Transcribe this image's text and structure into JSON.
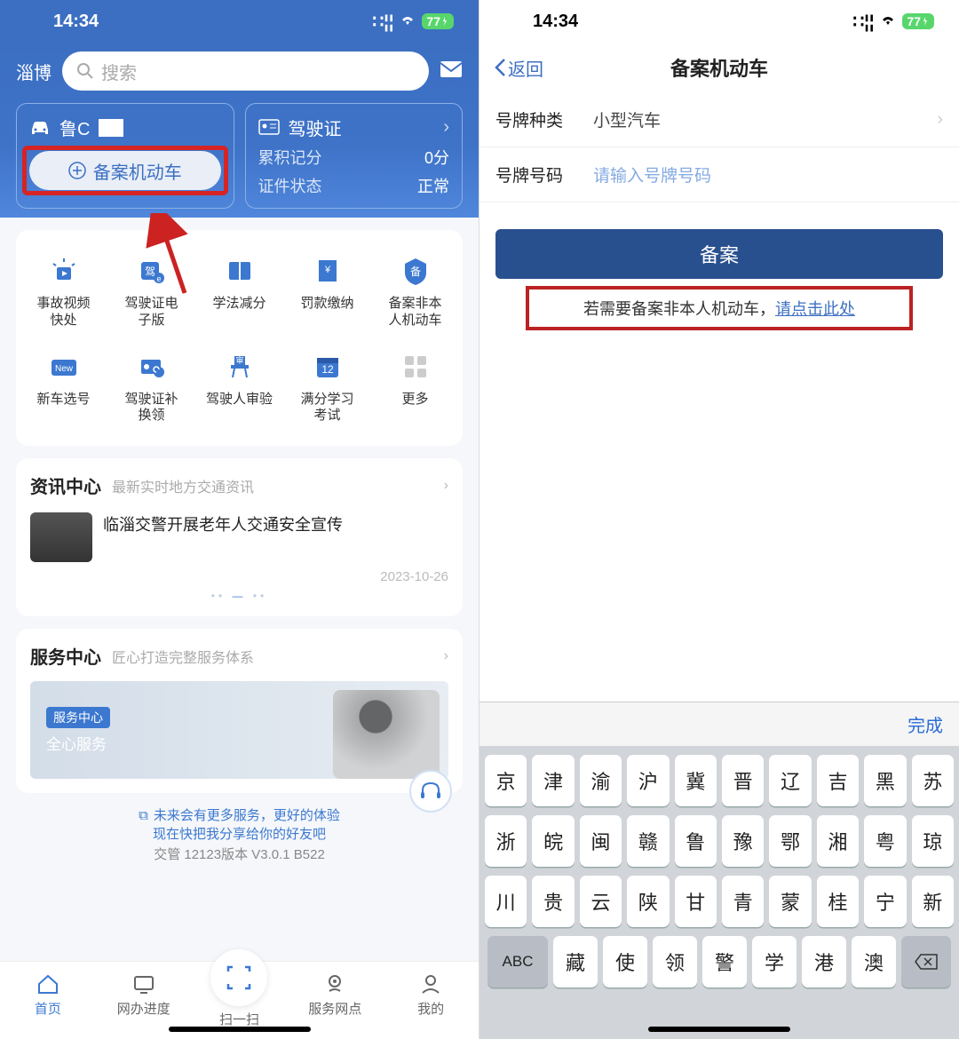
{
  "status": {
    "time": "14:34",
    "battery": "77"
  },
  "left": {
    "city": "淄博",
    "search_placeholder": "搜索",
    "vehicle_card": {
      "icon": "car-icon",
      "plate_prefix": "鲁C",
      "record_btn": "备案机动车"
    },
    "license_card": {
      "title": "驾驶证",
      "rows": [
        {
          "k": "累积记分",
          "v": "0分"
        },
        {
          "k": "证件状态",
          "v": "正常"
        }
      ]
    },
    "grid": [
      {
        "label": "事故视频\n快处",
        "icon": "siren"
      },
      {
        "label": "驾驶证电\n子版",
        "icon": "license-e"
      },
      {
        "label": "学法减分",
        "icon": "book"
      },
      {
        "label": "罚款缴纳",
        "icon": "receipt"
      },
      {
        "label": "备案非本\n人机动车",
        "icon": "badge"
      },
      {
        "label": "新车选号",
        "icon": "new"
      },
      {
        "label": "驾驶证补\n换领",
        "icon": "card-refresh"
      },
      {
        "label": "驾驶人审验",
        "icon": "podium"
      },
      {
        "label": "满分学习\n考试",
        "icon": "calendar-12"
      },
      {
        "label": "更多",
        "icon": "dots"
      }
    ],
    "news": {
      "title": "资讯中心",
      "subtitle": "最新实时地方交通资讯",
      "item_title": "临淄交警开展老年人交通安全宣传",
      "item_date": "2023-10-26"
    },
    "service": {
      "title": "服务中心",
      "subtitle": "匠心打造完整服务体系",
      "banner_tag": "服务中心",
      "banner_text": "全心服务"
    },
    "footer_note": "未来会有更多服务，更好的体验\n现在快把我分享给你的好友吧",
    "version": "交管 12123版本 V3.0.1 B522",
    "tabs": [
      "首页",
      "网办进度",
      "扫一扫",
      "服务网点",
      "我的"
    ]
  },
  "right": {
    "back": "返回",
    "title": "备案机动车",
    "plate_type_label": "号牌种类",
    "plate_type_value": "小型汽车",
    "plate_no_label": "号牌号码",
    "plate_no_placeholder": "请输入号牌号码",
    "submit": "备案",
    "hint_prefix": "若需要备案非本人机动车，",
    "hint_link": "请点击此处",
    "kb_done": "完成",
    "kb_rows": [
      [
        "京",
        "津",
        "渝",
        "沪",
        "冀",
        "晋",
        "辽",
        "吉",
        "黑",
        "苏"
      ],
      [
        "浙",
        "皖",
        "闽",
        "赣",
        "鲁",
        "豫",
        "鄂",
        "湘",
        "粤",
        "琼"
      ],
      [
        "川",
        "贵",
        "云",
        "陕",
        "甘",
        "青",
        "蒙",
        "桂",
        "宁",
        "新"
      ]
    ],
    "kb_row4": {
      "abc": "ABC",
      "keys": [
        "藏",
        "使",
        "领",
        "警",
        "学",
        "港",
        "澳"
      ],
      "del": "⌫"
    }
  }
}
